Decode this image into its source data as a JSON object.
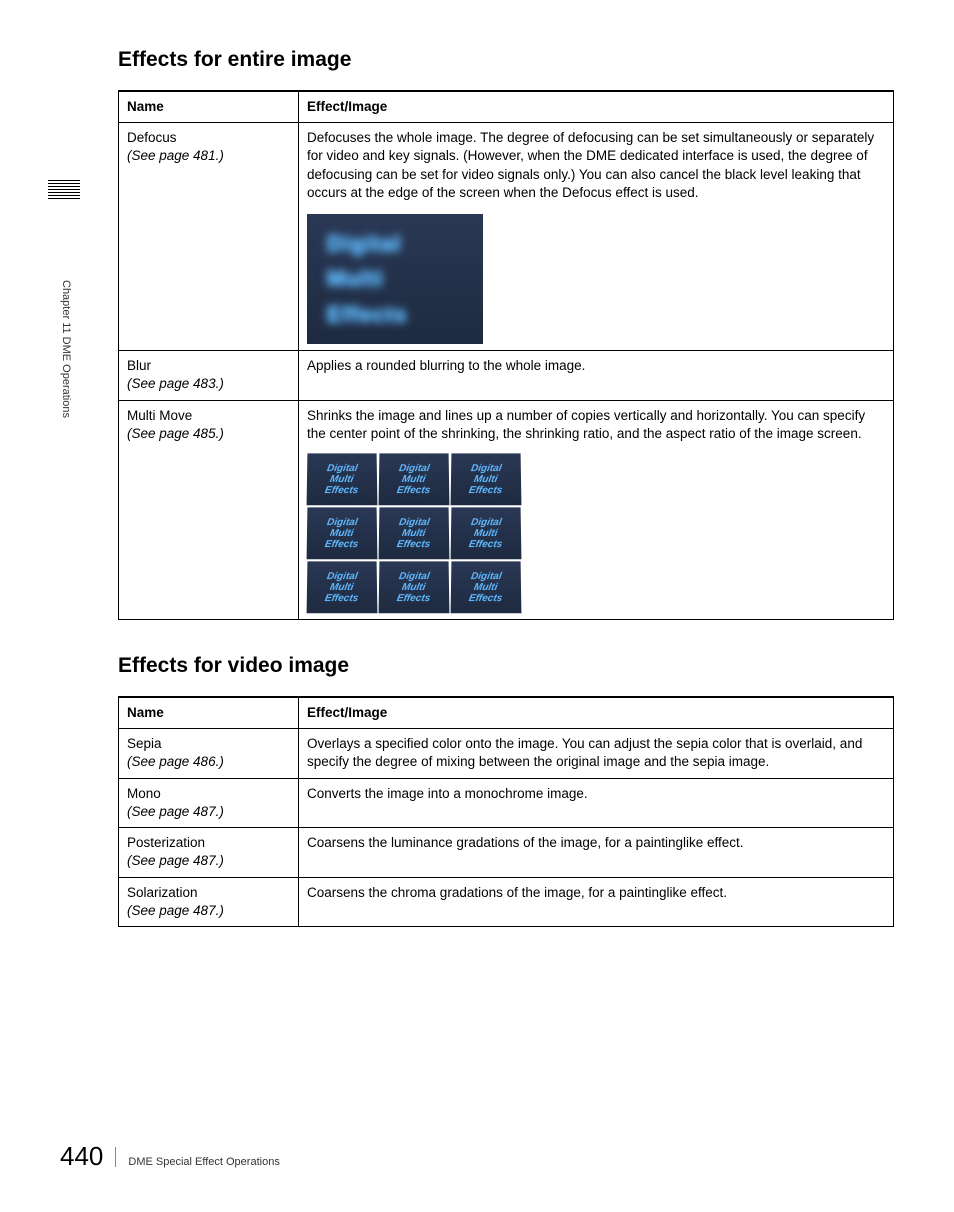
{
  "sidebar": {
    "chapter_label": "Chapter 11   DME Operations"
  },
  "heading1": "Effects for entire image",
  "table1": {
    "col1_header": "Name",
    "col2_header": "Effect/Image",
    "rows": [
      {
        "name": "Defocus",
        "ref": "(See page 481.)",
        "desc": "Defocuses the whole image. The degree of defocusing can be set simultaneously or separately for video and key signals. (However, when the DME dedicated interface is used, the degree of defocusing can be set for video signals only.) You can also cancel the black level leaking that occurs at the edge of the screen when the Defocus effect is used."
      },
      {
        "name": "Blur",
        "ref": "(See page 483.)",
        "desc": "Applies a rounded blurring to the whole image."
      },
      {
        "name": "Multi Move",
        "ref": "(See page 485.)",
        "desc": "Shrinks the image and lines up a number of copies vertically and horizontally. You can specify the center point of the shrinking, the shrinking ratio, and the aspect ratio of the image screen."
      }
    ]
  },
  "heading2": "Effects for video image",
  "table2": {
    "col1_header": "Name",
    "col2_header": "Effect/Image",
    "rows": [
      {
        "name": "Sepia",
        "ref": "(See page 486.)",
        "desc": "Overlays a specified color onto the image. You can adjust the sepia color that is overlaid, and specify the degree of mixing between the original image and the sepia image."
      },
      {
        "name": "Mono",
        "ref": "(See page 487.)",
        "desc": "Converts the image into a monochrome image."
      },
      {
        "name": "Posterization",
        "ref": "(See page 487.)",
        "desc": "Coarsens the luminance gradations of the image, for a paintinglike effect."
      },
      {
        "name": "Solarization",
        "ref": "(See page 487.)",
        "desc": "Coarsens the chroma gradations of the image, for a paintinglike effect."
      }
    ]
  },
  "defocus_img": {
    "line1": "Digital",
    "line2": "Multi",
    "line3": "Effects"
  },
  "multimove_tile": {
    "line1": "Digital",
    "line2": "Multi",
    "line3": "Effects"
  },
  "footer": {
    "page_number": "440",
    "section_title": "DME Special Effect Operations"
  }
}
